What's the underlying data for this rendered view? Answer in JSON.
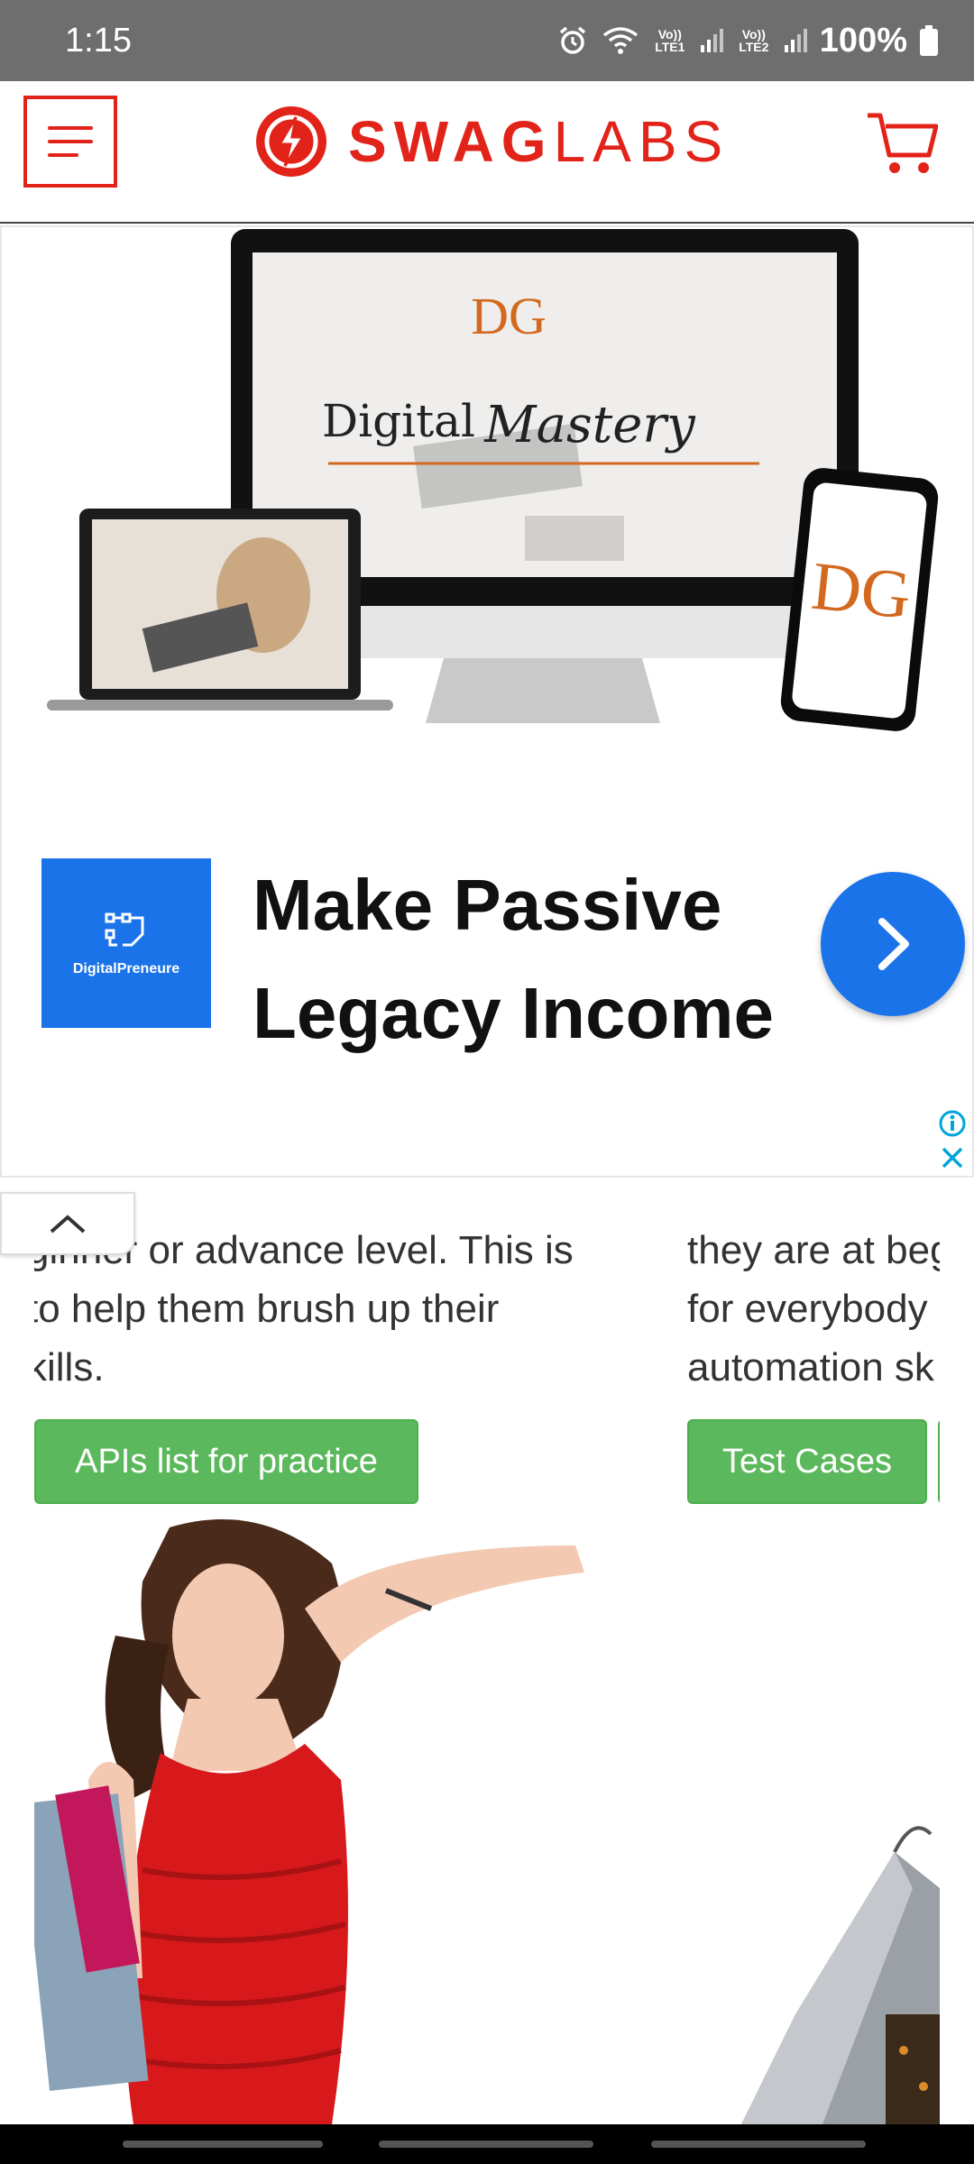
{
  "status": {
    "time": "1:15",
    "battery": "100%",
    "sim1": "Vo)) LTE1",
    "sim2": "Vo)) LTE2"
  },
  "header": {
    "logo_bold": "SWAG",
    "logo_light": "LABS",
    "brand_color": "#e2231a"
  },
  "ad": {
    "headline": "Make Passive Legacy Income",
    "advertiser": "DigitalPreneure",
    "screen_title_a": "Digital",
    "screen_title_b": "Mastery",
    "screen_logo": "DG",
    "phone_logo": "DG",
    "accent": "#1a73e8"
  },
  "cards": [
    {
      "text_lines": [
        "ginner or advance level. This is",
        "to help them brush up their",
        "kills."
      ],
      "button": "APIs list for practice"
    },
    {
      "text_lines": [
        "they are at beg",
        "for everybody",
        "automation sk"
      ],
      "button": "Test Cases"
    }
  ]
}
